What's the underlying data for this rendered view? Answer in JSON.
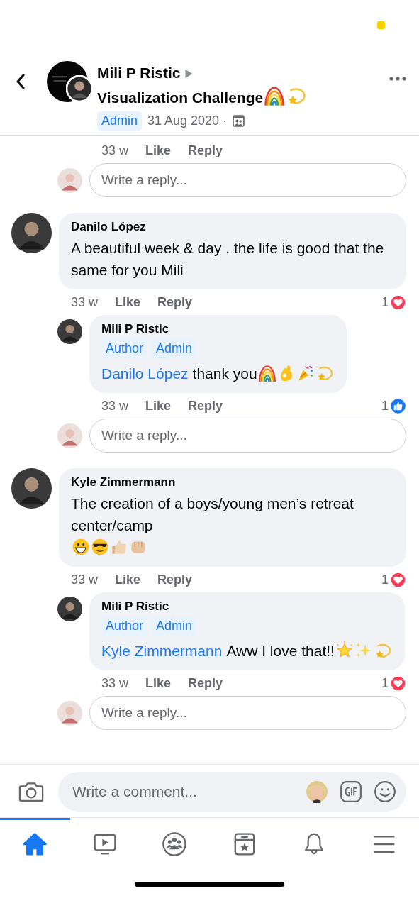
{
  "header": {
    "author": "Mili P Ristic",
    "group": "Visualization Challenge",
    "title_emoji": [
      {
        "kind": "rainbow"
      },
      {
        "kind": "dizzy"
      }
    ],
    "badges": [
      "Admin"
    ],
    "date": "31 Aug 2020 ·"
  },
  "thread": [
    {
      "kind": "actions",
      "nested": true,
      "time": "33 w",
      "like": "Like",
      "reply": "Reply"
    },
    {
      "kind": "reply_box",
      "placeholder": "Write a reply..."
    },
    {
      "kind": "comment",
      "nested": false,
      "author": "Danilo López",
      "text": "A beautiful week & day , the life is good that the same for you Mili",
      "time": "33 w",
      "like": "Like",
      "reply": "Reply",
      "reaction": {
        "count": "1",
        "kind": "love"
      }
    },
    {
      "kind": "comment",
      "nested": true,
      "author": "Mili P Ristic",
      "badges": [
        "Author",
        "Admin"
      ],
      "mention": "Danilo López",
      "text": "thank you",
      "emoji": [
        {
          "kind": "rainbow"
        },
        {
          "kind": "ok"
        },
        {
          "kind": "party"
        },
        {
          "kind": "dizzy"
        }
      ],
      "time": "33 w",
      "like": "Like",
      "reply": "Reply",
      "reaction": {
        "count": "1",
        "kind": "like"
      }
    },
    {
      "kind": "reply_box",
      "placeholder": "Write a reply..."
    },
    {
      "kind": "comment",
      "nested": false,
      "author": "Kyle Zimmermann",
      "text": "The creation of a boys/young men’s retreat center/camp",
      "emoji": [
        {
          "kind": "grin"
        },
        {
          "kind": "sunglasses"
        },
        {
          "kind": "thumbs"
        },
        {
          "kind": "fist"
        }
      ],
      "time": "33 w",
      "like": "Like",
      "reply": "Reply",
      "reaction": {
        "count": "1",
        "kind": "love"
      }
    },
    {
      "kind": "comment",
      "nested": true,
      "author": "Mili P Ristic",
      "badges": [
        "Author",
        "Admin"
      ],
      "mention": "Kyle Zimmermann",
      "text": "Aww I love that!!",
      "emoji": [
        {
          "kind": "glowstar"
        },
        {
          "kind": "sparkles"
        },
        {
          "kind": "dizzy"
        }
      ],
      "time": "33 w",
      "like": "Like",
      "reply": "Reply",
      "reaction": {
        "count": "1",
        "kind": "love"
      }
    },
    {
      "kind": "reply_box",
      "placeholder": "Write a reply..."
    }
  ],
  "composer": {
    "placeholder": "Write a comment..."
  },
  "tabs": [
    {
      "kind": "home",
      "selected": true
    },
    {
      "kind": "video",
      "selected": false
    },
    {
      "kind": "groups",
      "selected": false
    },
    {
      "kind": "pages",
      "selected": false
    },
    {
      "kind": "bell",
      "selected": false
    },
    {
      "kind": "menu",
      "selected": false
    }
  ]
}
